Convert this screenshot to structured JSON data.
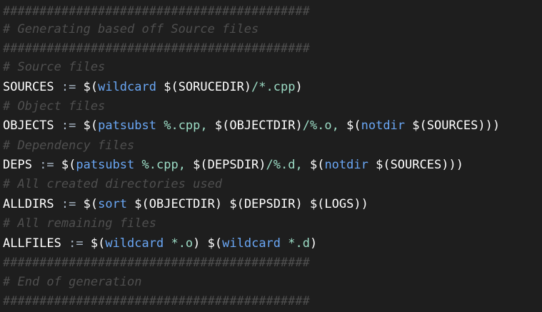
{
  "editor": {
    "background": "#1e1e1e",
    "comment_color": "#4f4f4f",
    "function_color": "#6aa7f5",
    "pattern_color": "#9cdcc5",
    "lines": [
      {
        "type": "comment",
        "text": "##########################################"
      },
      {
        "type": "comment",
        "text": "# Generating based off Source files"
      },
      {
        "type": "comment",
        "text": "##########################################"
      },
      {
        "type": "comment",
        "text": "# Source files"
      },
      {
        "type": "code",
        "tokens": [
          {
            "cls": "var",
            "text": "SOURCES "
          },
          {
            "cls": "op",
            "text": ":= "
          },
          {
            "cls": "dollar",
            "text": "$("
          },
          {
            "cls": "fn",
            "text": "wildcard "
          },
          {
            "cls": "dollar",
            "text": "$(SORUCEDIR)"
          },
          {
            "cls": "str",
            "text": "/*.cpp"
          },
          {
            "cls": "paren",
            "text": ")"
          }
        ]
      },
      {
        "type": "comment",
        "text": "# Object files"
      },
      {
        "type": "code",
        "tokens": [
          {
            "cls": "var",
            "text": "OBJECTS "
          },
          {
            "cls": "op",
            "text": ":= "
          },
          {
            "cls": "dollar",
            "text": "$("
          },
          {
            "cls": "fn",
            "text": "patsubst "
          },
          {
            "cls": "str",
            "text": "%.cpp, "
          },
          {
            "cls": "dollar",
            "text": "$(OBJECTDIR)"
          },
          {
            "cls": "str",
            "text": "/%.o, "
          },
          {
            "cls": "dollar",
            "text": "$("
          },
          {
            "cls": "fn",
            "text": "notdir "
          },
          {
            "cls": "dollar",
            "text": "$(SOURCES)"
          },
          {
            "cls": "paren",
            "text": "))"
          }
        ]
      },
      {
        "type": "comment",
        "text": "# Dependency files"
      },
      {
        "type": "code",
        "tokens": [
          {
            "cls": "var",
            "text": "DEPS "
          },
          {
            "cls": "op",
            "text": ":= "
          },
          {
            "cls": "dollar",
            "text": "$("
          },
          {
            "cls": "fn",
            "text": "patsubst "
          },
          {
            "cls": "str",
            "text": "%.cpp, "
          },
          {
            "cls": "dollar",
            "text": "$(DEPSDIR)"
          },
          {
            "cls": "str",
            "text": "/%.d, "
          },
          {
            "cls": "dollar",
            "text": "$("
          },
          {
            "cls": "fn",
            "text": "notdir "
          },
          {
            "cls": "dollar",
            "text": "$(SOURCES)"
          },
          {
            "cls": "paren",
            "text": "))"
          }
        ]
      },
      {
        "type": "comment",
        "text": "# All created directories used"
      },
      {
        "type": "code",
        "tokens": [
          {
            "cls": "var",
            "text": "ALLDIRS "
          },
          {
            "cls": "op",
            "text": ":= "
          },
          {
            "cls": "dollar",
            "text": "$("
          },
          {
            "cls": "fn",
            "text": "sort "
          },
          {
            "cls": "dollar",
            "text": "$(OBJECTDIR) "
          },
          {
            "cls": "dollar",
            "text": "$(DEPSDIR) "
          },
          {
            "cls": "dollar",
            "text": "$(LOGS)"
          },
          {
            "cls": "paren",
            "text": ")"
          }
        ]
      },
      {
        "type": "comment",
        "text": "# All remaining files"
      },
      {
        "type": "code",
        "tokens": [
          {
            "cls": "var",
            "text": "ALLFILES "
          },
          {
            "cls": "op",
            "text": ":= "
          },
          {
            "cls": "dollar",
            "text": "$("
          },
          {
            "cls": "fn",
            "text": "wildcard "
          },
          {
            "cls": "str",
            "text": "*.o"
          },
          {
            "cls": "paren",
            "text": ") "
          },
          {
            "cls": "dollar",
            "text": "$("
          },
          {
            "cls": "fn",
            "text": "wildcard "
          },
          {
            "cls": "str",
            "text": "*.d"
          },
          {
            "cls": "paren",
            "text": ")"
          }
        ]
      },
      {
        "type": "comment",
        "text": "##########################################"
      },
      {
        "type": "comment",
        "text": "# End of generation"
      },
      {
        "type": "comment",
        "text": "##########################################"
      }
    ]
  }
}
